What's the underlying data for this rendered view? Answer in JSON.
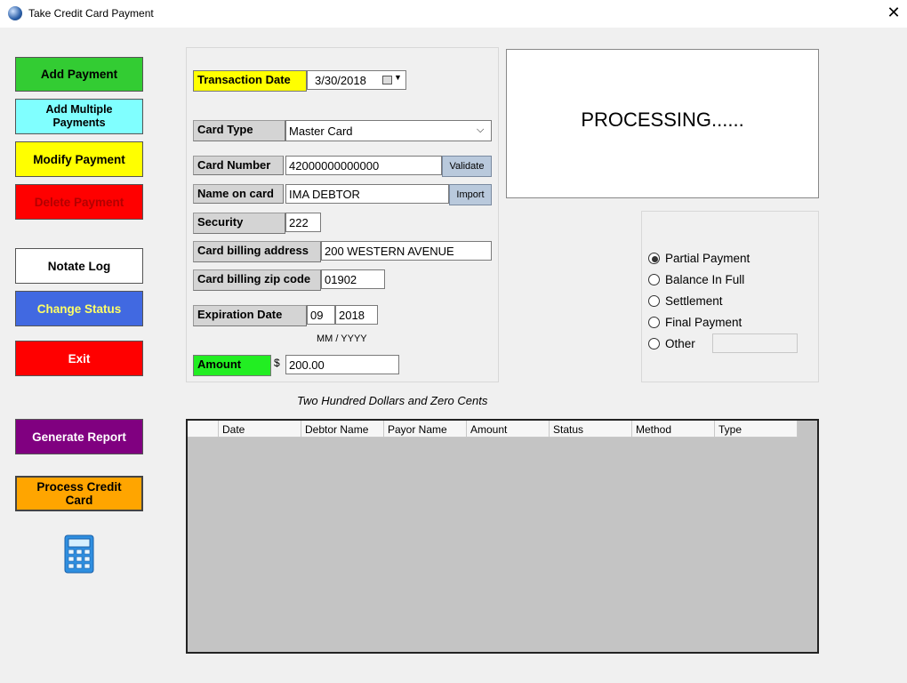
{
  "window": {
    "title": "Take Credit Card Payment"
  },
  "buttons": {
    "add_payment": "Add Payment",
    "add_multiple": "Add Multiple Payments",
    "modify_payment": "Modify Payment",
    "delete_payment": "Delete Payment",
    "notate_log": "Notate Log",
    "change_status": "Change Status",
    "exit": "Exit",
    "generate_report": "Generate Report",
    "process_cc": "Process Credit Card",
    "calculator_icon": "calculator-icon"
  },
  "form": {
    "transaction_date_label": "Transaction Date",
    "transaction_date": "3/30/2018",
    "card_type_label": "Card Type",
    "card_type": "Master Card",
    "card_number_label": "Card Number",
    "card_number": "42000000000000",
    "validate": "Validate",
    "name_label": "Name on card",
    "name": "IMA DEBTOR",
    "import": "Import",
    "security_label": "Security",
    "security": "222",
    "address_label": "Card billing address",
    "address": "200 WESTERN AVENUE",
    "zip_label": "Card billing zip code",
    "zip": "01902",
    "exp_label": "Expiration Date",
    "exp_month": "09",
    "exp_year": "2018",
    "exp_hint": "MM / YYYY",
    "amount_label": "Amount",
    "currency": "$",
    "amount": "200.00",
    "amount_words": "Two Hundred  Dollars and Zero Cents"
  },
  "status": {
    "processing": "PROCESSING......"
  },
  "payment_options": [
    "Partial Payment",
    "Balance In Full",
    "Settlement",
    "Final Payment",
    "Other"
  ],
  "payment_selected": "Partial Payment",
  "table": {
    "columns": [
      "Date",
      "Debtor Name",
      "Payor Name",
      "Amount",
      "Status",
      "Method",
      "Type"
    ]
  },
  "colors": {
    "add_payment": "#33cc33",
    "add_multiple": "#80ffff",
    "modify_payment": "#ffff00",
    "delete_payment": "#ff0000",
    "change_status": "#4169e1",
    "generate_report": "#800080",
    "process_cc": "#ffa500"
  }
}
